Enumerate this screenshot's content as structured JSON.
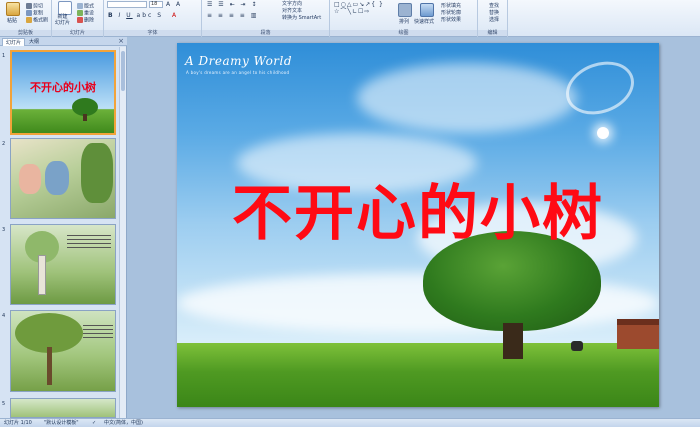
{
  "ribbon": {
    "clipboard": {
      "paste": "粘贴",
      "cut": "剪切",
      "copy": "复制",
      "format_painter": "格式刷",
      "label": "剪贴板"
    },
    "slides": {
      "new_slide": "新建\n幻灯片",
      "layout": "版式",
      "reset": "重设",
      "delete": "删除",
      "label": "幻灯片"
    },
    "font": {
      "font_name": "",
      "font_size": "18",
      "label": "字体"
    },
    "paragraph": {
      "text_direction": "文字方向",
      "align_text": "对齐文本",
      "smartart": "转换为 SmartArt",
      "label": "段落"
    },
    "drawing": {
      "arrange": "排列",
      "quick_styles": "快速样式",
      "shape_fill": "形状填充",
      "shape_outline": "形状轮廓",
      "shape_effects": "形状效果",
      "label": "绘图"
    },
    "editing": {
      "find": "查找",
      "replace": "替换",
      "select": "选择",
      "label": "编辑"
    }
  },
  "panel": {
    "tab_slides": "幻灯片",
    "tab_outline": "大纲",
    "close": "×",
    "thumbs": [
      {
        "num": "1",
        "title": "不开心的小树"
      },
      {
        "num": "2"
      },
      {
        "num": "3"
      },
      {
        "num": "4"
      },
      {
        "num": "5"
      }
    ]
  },
  "slide": {
    "brand": "A Dreamy World",
    "tagline": "A boy's dreams are an angel to his childhood",
    "title": "不开心的小树"
  },
  "status": {
    "slide_count": "幻灯片 1/10",
    "theme": "\"默认设计模板\"",
    "language": "中文(简体，中国)"
  },
  "colors": {
    "title_red": "#ff0a14",
    "ribbon_bg": "#dbe7f5",
    "stage_bg": "#a8c1dd"
  }
}
